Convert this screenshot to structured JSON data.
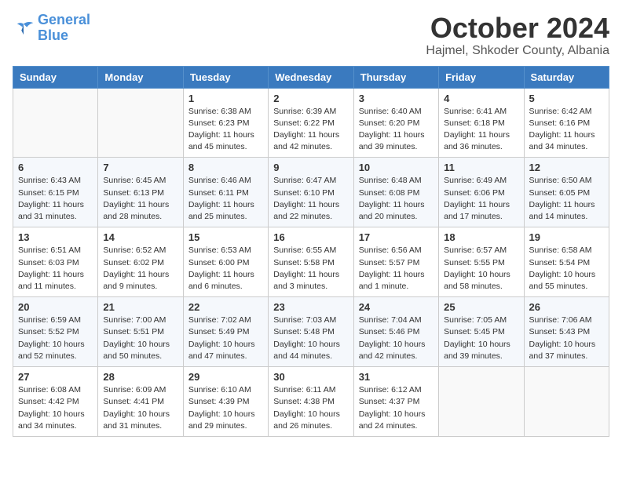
{
  "header": {
    "logo_line1": "General",
    "logo_line2": "Blue",
    "month": "October 2024",
    "location": "Hajmel, Shkoder County, Albania"
  },
  "weekdays": [
    "Sunday",
    "Monday",
    "Tuesday",
    "Wednesday",
    "Thursday",
    "Friday",
    "Saturday"
  ],
  "weeks": [
    [
      {
        "day": "",
        "sunrise": "",
        "sunset": "",
        "daylight": ""
      },
      {
        "day": "",
        "sunrise": "",
        "sunset": "",
        "daylight": ""
      },
      {
        "day": "1",
        "sunrise": "Sunrise: 6:38 AM",
        "sunset": "Sunset: 6:23 PM",
        "daylight": "Daylight: 11 hours and 45 minutes."
      },
      {
        "day": "2",
        "sunrise": "Sunrise: 6:39 AM",
        "sunset": "Sunset: 6:22 PM",
        "daylight": "Daylight: 11 hours and 42 minutes."
      },
      {
        "day": "3",
        "sunrise": "Sunrise: 6:40 AM",
        "sunset": "Sunset: 6:20 PM",
        "daylight": "Daylight: 11 hours and 39 minutes."
      },
      {
        "day": "4",
        "sunrise": "Sunrise: 6:41 AM",
        "sunset": "Sunset: 6:18 PM",
        "daylight": "Daylight: 11 hours and 36 minutes."
      },
      {
        "day": "5",
        "sunrise": "Sunrise: 6:42 AM",
        "sunset": "Sunset: 6:16 PM",
        "daylight": "Daylight: 11 hours and 34 minutes."
      }
    ],
    [
      {
        "day": "6",
        "sunrise": "Sunrise: 6:43 AM",
        "sunset": "Sunset: 6:15 PM",
        "daylight": "Daylight: 11 hours and 31 minutes."
      },
      {
        "day": "7",
        "sunrise": "Sunrise: 6:45 AM",
        "sunset": "Sunset: 6:13 PM",
        "daylight": "Daylight: 11 hours and 28 minutes."
      },
      {
        "day": "8",
        "sunrise": "Sunrise: 6:46 AM",
        "sunset": "Sunset: 6:11 PM",
        "daylight": "Daylight: 11 hours and 25 minutes."
      },
      {
        "day": "9",
        "sunrise": "Sunrise: 6:47 AM",
        "sunset": "Sunset: 6:10 PM",
        "daylight": "Daylight: 11 hours and 22 minutes."
      },
      {
        "day": "10",
        "sunrise": "Sunrise: 6:48 AM",
        "sunset": "Sunset: 6:08 PM",
        "daylight": "Daylight: 11 hours and 20 minutes."
      },
      {
        "day": "11",
        "sunrise": "Sunrise: 6:49 AM",
        "sunset": "Sunset: 6:06 PM",
        "daylight": "Daylight: 11 hours and 17 minutes."
      },
      {
        "day": "12",
        "sunrise": "Sunrise: 6:50 AM",
        "sunset": "Sunset: 6:05 PM",
        "daylight": "Daylight: 11 hours and 14 minutes."
      }
    ],
    [
      {
        "day": "13",
        "sunrise": "Sunrise: 6:51 AM",
        "sunset": "Sunset: 6:03 PM",
        "daylight": "Daylight: 11 hours and 11 minutes."
      },
      {
        "day": "14",
        "sunrise": "Sunrise: 6:52 AM",
        "sunset": "Sunset: 6:02 PM",
        "daylight": "Daylight: 11 hours and 9 minutes."
      },
      {
        "day": "15",
        "sunrise": "Sunrise: 6:53 AM",
        "sunset": "Sunset: 6:00 PM",
        "daylight": "Daylight: 11 hours and 6 minutes."
      },
      {
        "day": "16",
        "sunrise": "Sunrise: 6:55 AM",
        "sunset": "Sunset: 5:58 PM",
        "daylight": "Daylight: 11 hours and 3 minutes."
      },
      {
        "day": "17",
        "sunrise": "Sunrise: 6:56 AM",
        "sunset": "Sunset: 5:57 PM",
        "daylight": "Daylight: 11 hours and 1 minute."
      },
      {
        "day": "18",
        "sunrise": "Sunrise: 6:57 AM",
        "sunset": "Sunset: 5:55 PM",
        "daylight": "Daylight: 10 hours and 58 minutes."
      },
      {
        "day": "19",
        "sunrise": "Sunrise: 6:58 AM",
        "sunset": "Sunset: 5:54 PM",
        "daylight": "Daylight: 10 hours and 55 minutes."
      }
    ],
    [
      {
        "day": "20",
        "sunrise": "Sunrise: 6:59 AM",
        "sunset": "Sunset: 5:52 PM",
        "daylight": "Daylight: 10 hours and 52 minutes."
      },
      {
        "day": "21",
        "sunrise": "Sunrise: 7:00 AM",
        "sunset": "Sunset: 5:51 PM",
        "daylight": "Daylight: 10 hours and 50 minutes."
      },
      {
        "day": "22",
        "sunrise": "Sunrise: 7:02 AM",
        "sunset": "Sunset: 5:49 PM",
        "daylight": "Daylight: 10 hours and 47 minutes."
      },
      {
        "day": "23",
        "sunrise": "Sunrise: 7:03 AM",
        "sunset": "Sunset: 5:48 PM",
        "daylight": "Daylight: 10 hours and 44 minutes."
      },
      {
        "day": "24",
        "sunrise": "Sunrise: 7:04 AM",
        "sunset": "Sunset: 5:46 PM",
        "daylight": "Daylight: 10 hours and 42 minutes."
      },
      {
        "day": "25",
        "sunrise": "Sunrise: 7:05 AM",
        "sunset": "Sunset: 5:45 PM",
        "daylight": "Daylight: 10 hours and 39 minutes."
      },
      {
        "day": "26",
        "sunrise": "Sunrise: 7:06 AM",
        "sunset": "Sunset: 5:43 PM",
        "daylight": "Daylight: 10 hours and 37 minutes."
      }
    ],
    [
      {
        "day": "27",
        "sunrise": "Sunrise: 6:08 AM",
        "sunset": "Sunset: 4:42 PM",
        "daylight": "Daylight: 10 hours and 34 minutes."
      },
      {
        "day": "28",
        "sunrise": "Sunrise: 6:09 AM",
        "sunset": "Sunset: 4:41 PM",
        "daylight": "Daylight: 10 hours and 31 minutes."
      },
      {
        "day": "29",
        "sunrise": "Sunrise: 6:10 AM",
        "sunset": "Sunset: 4:39 PM",
        "daylight": "Daylight: 10 hours and 29 minutes."
      },
      {
        "day": "30",
        "sunrise": "Sunrise: 6:11 AM",
        "sunset": "Sunset: 4:38 PM",
        "daylight": "Daylight: 10 hours and 26 minutes."
      },
      {
        "day": "31",
        "sunrise": "Sunrise: 6:12 AM",
        "sunset": "Sunset: 4:37 PM",
        "daylight": "Daylight: 10 hours and 24 minutes."
      },
      {
        "day": "",
        "sunrise": "",
        "sunset": "",
        "daylight": ""
      },
      {
        "day": "",
        "sunrise": "",
        "sunset": "",
        "daylight": ""
      }
    ]
  ]
}
